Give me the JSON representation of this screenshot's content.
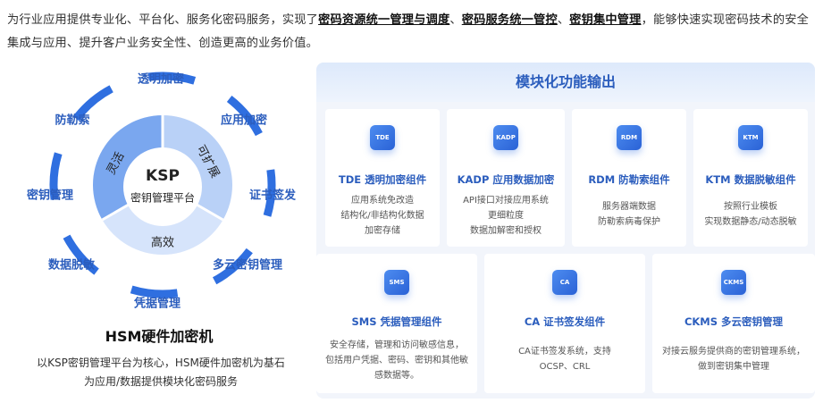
{
  "intro": {
    "p1": "为行业应用提供专业化、平台化、服务化密码服务，实现了",
    "b1": "密码资源统一管理与调度",
    "s1": "、",
    "b2": "密码服务统一管控",
    "s2": "、",
    "b3": "密钥集中管理",
    "p2": "，能够快速实现密码技术的安全集成与应用、提升客户业务安全性、创造更高的业务价值。"
  },
  "diagram": {
    "ring_labels": [
      "透明加密",
      "应用加密",
      "证书签发",
      "多云密钥管理",
      "凭据管理",
      "数据脱敏",
      "密钥管理",
      "防勒索"
    ],
    "core_title": "KSP",
    "core_subtitle": "密钥管理平台",
    "segments": {
      "top_left": "灵活",
      "top_right": "可扩展",
      "bottom": "高效"
    },
    "colors": {
      "ring": "#2f6fe0",
      "core_dark": "#7aa7ef",
      "core_light": "#b9d1f7",
      "center": "#ffffff"
    }
  },
  "hsm": {
    "title": "HSM硬件加密机",
    "desc_line1": "以KSP密钥管理平台为核心，HSM硬件加密机为基石",
    "desc_line2": "为应用/数据提供模块化密码服务"
  },
  "panel": {
    "title": "模块化功能输出",
    "row1": [
      {
        "icon": "TDE",
        "name": "TDE 透明加密组件",
        "lines": [
          "应用系统免改造",
          "结构化/非结构化数据",
          "加密存储"
        ]
      },
      {
        "icon": "KADP",
        "name": "KADP 应用数据加密",
        "lines": [
          "API接口对接应用系统",
          "更细粒度",
          "数据加解密和授权"
        ]
      },
      {
        "icon": "RDM",
        "name": "RDM 防勒索组件",
        "lines": [
          "服务器端数据",
          "防勒索病毒保护"
        ]
      },
      {
        "icon": "KTM",
        "name": "KTM 数据脱敏组件",
        "lines": [
          "按照行业模板",
          "实现数据静态/动态脱敏"
        ]
      }
    ],
    "row2": [
      {
        "icon": "SMS",
        "name": "SMS 凭据管理组件",
        "lines": [
          "安全存储，管理和访问敏感信息，",
          "包括用户凭据、密码、密钥和其他敏",
          "感数据等。"
        ]
      },
      {
        "icon": "CA",
        "name": "CA 证书签发组件",
        "lines": [
          "CA证书签发系统，支持",
          "OCSP、CRL"
        ]
      },
      {
        "icon": "CKMS",
        "name": "CKMS 多云密钥管理",
        "lines": [
          "对接云服务提供商的密钥管理系统，",
          "做到密钥集中管理"
        ]
      }
    ]
  }
}
